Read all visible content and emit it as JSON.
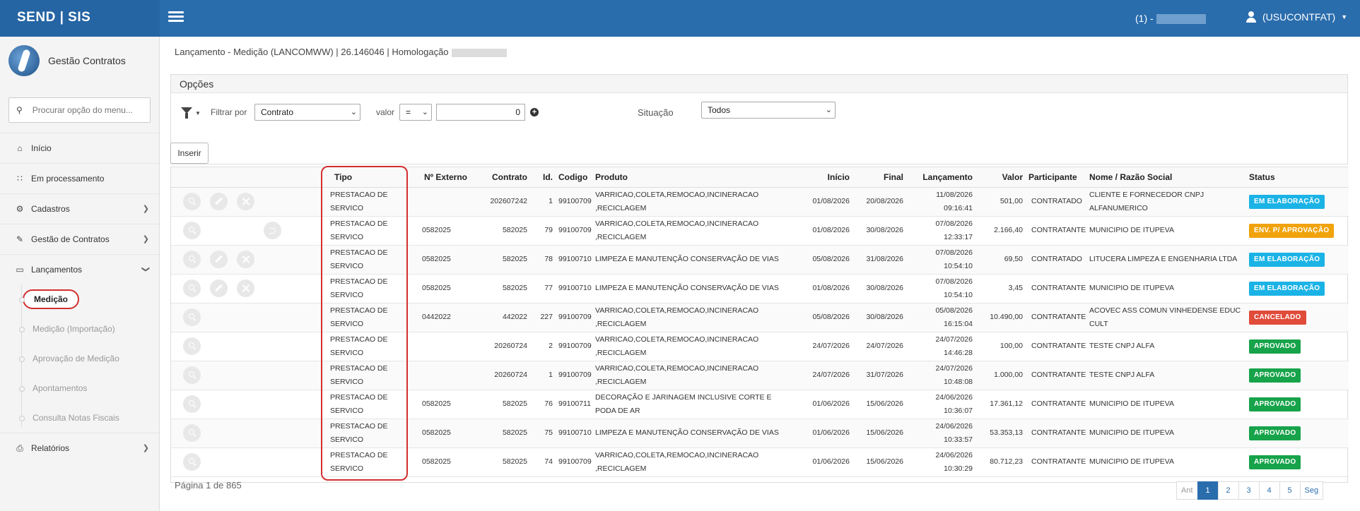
{
  "header": {
    "brand": "SEND | SIS",
    "environment": "(1) -",
    "user": "(USUCONTFAT)"
  },
  "sidebar": {
    "module": "Gestão Contratos",
    "search_placeholder": "Procurar opção do menu...",
    "items": [
      {
        "label": "Início",
        "icon": "home-icon"
      },
      {
        "label": "Em processamento",
        "icon": "spinner-icon"
      },
      {
        "label": "Cadastros",
        "icon": "gears-icon"
      },
      {
        "label": "Gestão de Contratos",
        "icon": "edit-doc-icon"
      },
      {
        "label": "Lançamentos",
        "icon": "laptop-icon"
      },
      {
        "label": "Relatórios",
        "icon": "print-icon"
      }
    ],
    "sub_items": [
      "Medição",
      "Medição (Importação)",
      "Aprovação de Medição",
      "Apontamentos",
      "Consulta Notas Fiscais"
    ]
  },
  "page": {
    "title": "Lançamento - Medição (LANCOMWW) | 26.146046 | Homologação"
  },
  "options": {
    "title": "Opções",
    "filter_label": "Filtrar por",
    "filter_field": "Contrato",
    "value_label": "valor",
    "operator": "=",
    "value": "0",
    "situacao_label": "Situação",
    "situacao": "Todos"
  },
  "insert_label": "Inserir",
  "table": {
    "columns": [
      "Tipo",
      "Nº Externo",
      "Contrato",
      "Id.",
      "Codigo",
      "Produto",
      "Início",
      "Final",
      "Lançamento",
      "Valor",
      "Participante",
      "Nome / Razão Social",
      "Status"
    ],
    "rows": [
      {
        "tipo": "PRESTACAO DE SERVICO",
        "externo": "",
        "contrato": "202607242",
        "id": "1",
        "codigo": "99100709",
        "produto": "VARRICAO,COLETA,REMOCAO,INCINERACAO ,RECICLAGEM",
        "inicio": "01/08/2026",
        "final": "20/08/2026",
        "lanc_date": "11/08/2026",
        "lanc_time": "09:16:41",
        "valor": "501,00",
        "participante": "CONTRATADO",
        "nome": "CLIENTE E FORNECEDOR CNPJ ALFANUMERICO",
        "status": "EM ELABORAÇÃO",
        "status_color": "#1bb3e6",
        "actions": [
          "search",
          "edit",
          "del"
        ]
      },
      {
        "tipo": "PRESTACAO DE SERVICO",
        "externo": "0582025",
        "contrato": "582025",
        "id": "79",
        "codigo": "99100709",
        "produto": "VARRICAO,COLETA,REMOCAO,INCINERACAO ,RECICLAGEM",
        "inicio": "01/08/2026",
        "final": "30/08/2026",
        "lanc_date": "07/08/2026",
        "lanc_time": "12:33:17",
        "valor": "2.166,40",
        "participante": "CONTRATANTE",
        "nome": "MUNICIPIO DE ITUPEVA",
        "status": "ENV. P/ APROVAÇÃO",
        "status_color": "#f0a30a",
        "actions": [
          "search",
          "blank",
          "blank",
          "undo"
        ]
      },
      {
        "tipo": "PRESTACAO DE SERVICO",
        "externo": "0582025",
        "contrato": "582025",
        "id": "78",
        "codigo": "99100710",
        "produto": "LIMPEZA E MANUTENÇÃO CONSERVAÇÃO DE VIAS",
        "inicio": "05/08/2026",
        "final": "31/08/2026",
        "lanc_date": "07/08/2026",
        "lanc_time": "10:54:10",
        "valor": "69,50",
        "participante": "CONTRATADO",
        "nome": "LITUCERA LIMPEZA E ENGENHARIA LTDA",
        "status": "EM ELABORAÇÃO",
        "status_color": "#1bb3e6",
        "actions": [
          "search",
          "edit",
          "del"
        ]
      },
      {
        "tipo": "PRESTACAO DE SERVICO",
        "externo": "0582025",
        "contrato": "582025",
        "id": "77",
        "codigo": "99100710",
        "produto": "LIMPEZA E MANUTENÇÃO CONSERVAÇÃO DE VIAS",
        "inicio": "01/08/2026",
        "final": "30/08/2026",
        "lanc_date": "07/08/2026",
        "lanc_time": "10:54:10",
        "valor": "3,45",
        "participante": "CONTRATANTE",
        "nome": "MUNICIPIO DE ITUPEVA",
        "status": "EM ELABORAÇÃO",
        "status_color": "#1bb3e6",
        "actions": [
          "search",
          "edit",
          "del"
        ]
      },
      {
        "tipo": "PRESTACAO DE SERVICO",
        "externo": "0442022",
        "contrato": "442022",
        "id": "227",
        "codigo": "99100709",
        "produto": "VARRICAO,COLETA,REMOCAO,INCINERACAO ,RECICLAGEM",
        "inicio": "05/08/2026",
        "final": "30/08/2026",
        "lanc_date": "05/08/2026",
        "lanc_time": "16:15:04",
        "valor": "10.490,00",
        "participante": "CONTRATANTE",
        "nome": "ACOVEC ASS COMUN VINHEDENSE EDUC CULT",
        "status": "CANCELADO",
        "status_color": "#e04b3a",
        "actions": [
          "search"
        ]
      },
      {
        "tipo": "PRESTACAO DE SERVICO",
        "externo": "",
        "contrato": "20260724",
        "id": "2",
        "codigo": "99100709",
        "produto": "VARRICAO,COLETA,REMOCAO,INCINERACAO ,RECICLAGEM",
        "inicio": "24/07/2026",
        "final": "24/07/2026",
        "lanc_date": "24/07/2026",
        "lanc_time": "14:46:28",
        "valor": "100,00",
        "participante": "CONTRATANTE",
        "nome": "TESTE CNPJ ALFA",
        "status": "APROVADO",
        "status_color": "#17a34a",
        "actions": [
          "search"
        ]
      },
      {
        "tipo": "PRESTACAO DE SERVICO",
        "externo": "",
        "contrato": "20260724",
        "id": "1",
        "codigo": "99100709",
        "produto": "VARRICAO,COLETA,REMOCAO,INCINERACAO ,RECICLAGEM",
        "inicio": "24/07/2026",
        "final": "31/07/2026",
        "lanc_date": "24/07/2026",
        "lanc_time": "10:48:08",
        "valor": "1.000,00",
        "participante": "CONTRATANTE",
        "nome": "TESTE CNPJ ALFA",
        "status": "APROVADO",
        "status_color": "#17a34a",
        "actions": [
          "search"
        ]
      },
      {
        "tipo": "PRESTACAO DE SERVICO",
        "externo": "0582025",
        "contrato": "582025",
        "id": "76",
        "codigo": "99100711",
        "produto": "DECORAÇÃO E JARINAGEM INCLUSIVE CORTE E PODA DE AR",
        "inicio": "01/06/2026",
        "final": "15/06/2026",
        "lanc_date": "24/06/2026",
        "lanc_time": "10:36:07",
        "valor": "17.361,12",
        "participante": "CONTRATANTE",
        "nome": "MUNICIPIO DE ITUPEVA",
        "status": "APROVADO",
        "status_color": "#17a34a",
        "actions": [
          "search"
        ]
      },
      {
        "tipo": "PRESTACAO DE SERVICO",
        "externo": "0582025",
        "contrato": "582025",
        "id": "75",
        "codigo": "99100710",
        "produto": "LIMPEZA E MANUTENÇÃO CONSERVAÇÃO DE VIAS",
        "inicio": "01/06/2026",
        "final": "15/06/2026",
        "lanc_date": "24/06/2026",
        "lanc_time": "10:33:57",
        "valor": "53.353,13",
        "participante": "CONTRATANTE",
        "nome": "MUNICIPIO DE ITUPEVA",
        "status": "APROVADO",
        "status_color": "#17a34a",
        "actions": [
          "search"
        ]
      },
      {
        "tipo": "PRESTACAO DE SERVICO",
        "externo": "0582025",
        "contrato": "582025",
        "id": "74",
        "codigo": "99100709",
        "produto": "VARRICAO,COLETA,REMOCAO,INCINERACAO ,RECICLAGEM",
        "inicio": "01/06/2026",
        "final": "15/06/2026",
        "lanc_date": "24/06/2026",
        "lanc_time": "10:30:29",
        "valor": "80.712,23",
        "participante": "CONTRATANTE",
        "nome": "MUNICIPIO DE ITUPEVA",
        "status": "APROVADO",
        "status_color": "#17a34a",
        "actions": [
          "search"
        ]
      }
    ]
  },
  "pagination": {
    "info": "Página 1 de 865",
    "prev": "Ant",
    "pages": [
      "1",
      "2",
      "3",
      "4",
      "5"
    ],
    "next": "Seg"
  }
}
